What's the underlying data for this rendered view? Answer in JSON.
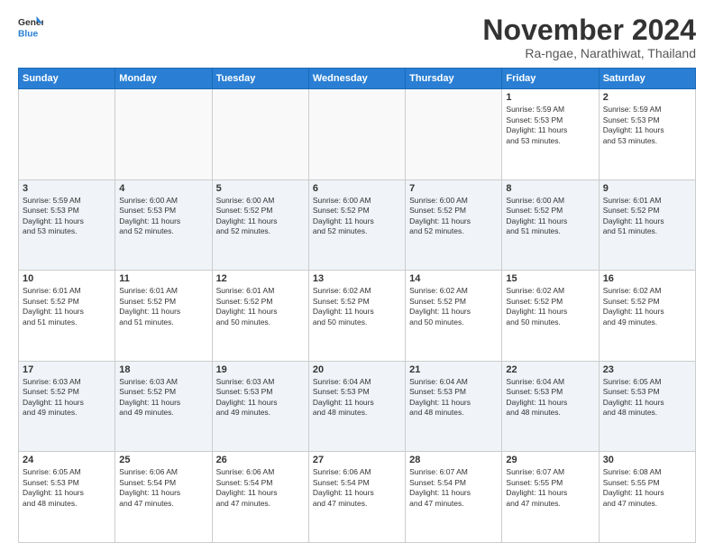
{
  "header": {
    "logo": {
      "general": "General",
      "blue": "Blue"
    },
    "title": "November 2024",
    "location": "Ra-ngae, Narathiwat, Thailand"
  },
  "weekdays": [
    "Sunday",
    "Monday",
    "Tuesday",
    "Wednesday",
    "Thursday",
    "Friday",
    "Saturday"
  ],
  "weeks": [
    [
      {
        "day": "",
        "info": ""
      },
      {
        "day": "",
        "info": ""
      },
      {
        "day": "",
        "info": ""
      },
      {
        "day": "",
        "info": ""
      },
      {
        "day": "",
        "info": ""
      },
      {
        "day": "1",
        "info": "Sunrise: 5:59 AM\nSunset: 5:53 PM\nDaylight: 11 hours\nand 53 minutes."
      },
      {
        "day": "2",
        "info": "Sunrise: 5:59 AM\nSunset: 5:53 PM\nDaylight: 11 hours\nand 53 minutes."
      }
    ],
    [
      {
        "day": "3",
        "info": "Sunrise: 5:59 AM\nSunset: 5:53 PM\nDaylight: 11 hours\nand 53 minutes."
      },
      {
        "day": "4",
        "info": "Sunrise: 6:00 AM\nSunset: 5:53 PM\nDaylight: 11 hours\nand 52 minutes."
      },
      {
        "day": "5",
        "info": "Sunrise: 6:00 AM\nSunset: 5:52 PM\nDaylight: 11 hours\nand 52 minutes."
      },
      {
        "day": "6",
        "info": "Sunrise: 6:00 AM\nSunset: 5:52 PM\nDaylight: 11 hours\nand 52 minutes."
      },
      {
        "day": "7",
        "info": "Sunrise: 6:00 AM\nSunset: 5:52 PM\nDaylight: 11 hours\nand 52 minutes."
      },
      {
        "day": "8",
        "info": "Sunrise: 6:00 AM\nSunset: 5:52 PM\nDaylight: 11 hours\nand 51 minutes."
      },
      {
        "day": "9",
        "info": "Sunrise: 6:01 AM\nSunset: 5:52 PM\nDaylight: 11 hours\nand 51 minutes."
      }
    ],
    [
      {
        "day": "10",
        "info": "Sunrise: 6:01 AM\nSunset: 5:52 PM\nDaylight: 11 hours\nand 51 minutes."
      },
      {
        "day": "11",
        "info": "Sunrise: 6:01 AM\nSunset: 5:52 PM\nDaylight: 11 hours\nand 51 minutes."
      },
      {
        "day": "12",
        "info": "Sunrise: 6:01 AM\nSunset: 5:52 PM\nDaylight: 11 hours\nand 50 minutes."
      },
      {
        "day": "13",
        "info": "Sunrise: 6:02 AM\nSunset: 5:52 PM\nDaylight: 11 hours\nand 50 minutes."
      },
      {
        "day": "14",
        "info": "Sunrise: 6:02 AM\nSunset: 5:52 PM\nDaylight: 11 hours\nand 50 minutes."
      },
      {
        "day": "15",
        "info": "Sunrise: 6:02 AM\nSunset: 5:52 PM\nDaylight: 11 hours\nand 50 minutes."
      },
      {
        "day": "16",
        "info": "Sunrise: 6:02 AM\nSunset: 5:52 PM\nDaylight: 11 hours\nand 49 minutes."
      }
    ],
    [
      {
        "day": "17",
        "info": "Sunrise: 6:03 AM\nSunset: 5:52 PM\nDaylight: 11 hours\nand 49 minutes."
      },
      {
        "day": "18",
        "info": "Sunrise: 6:03 AM\nSunset: 5:52 PM\nDaylight: 11 hours\nand 49 minutes."
      },
      {
        "day": "19",
        "info": "Sunrise: 6:03 AM\nSunset: 5:53 PM\nDaylight: 11 hours\nand 49 minutes."
      },
      {
        "day": "20",
        "info": "Sunrise: 6:04 AM\nSunset: 5:53 PM\nDaylight: 11 hours\nand 48 minutes."
      },
      {
        "day": "21",
        "info": "Sunrise: 6:04 AM\nSunset: 5:53 PM\nDaylight: 11 hours\nand 48 minutes."
      },
      {
        "day": "22",
        "info": "Sunrise: 6:04 AM\nSunset: 5:53 PM\nDaylight: 11 hours\nand 48 minutes."
      },
      {
        "day": "23",
        "info": "Sunrise: 6:05 AM\nSunset: 5:53 PM\nDaylight: 11 hours\nand 48 minutes."
      }
    ],
    [
      {
        "day": "24",
        "info": "Sunrise: 6:05 AM\nSunset: 5:53 PM\nDaylight: 11 hours\nand 48 minutes."
      },
      {
        "day": "25",
        "info": "Sunrise: 6:06 AM\nSunset: 5:54 PM\nDaylight: 11 hours\nand 47 minutes."
      },
      {
        "day": "26",
        "info": "Sunrise: 6:06 AM\nSunset: 5:54 PM\nDaylight: 11 hours\nand 47 minutes."
      },
      {
        "day": "27",
        "info": "Sunrise: 6:06 AM\nSunset: 5:54 PM\nDaylight: 11 hours\nand 47 minutes."
      },
      {
        "day": "28",
        "info": "Sunrise: 6:07 AM\nSunset: 5:54 PM\nDaylight: 11 hours\nand 47 minutes."
      },
      {
        "day": "29",
        "info": "Sunrise: 6:07 AM\nSunset: 5:55 PM\nDaylight: 11 hours\nand 47 minutes."
      },
      {
        "day": "30",
        "info": "Sunrise: 6:08 AM\nSunset: 5:55 PM\nDaylight: 11 hours\nand 47 minutes."
      }
    ]
  ]
}
